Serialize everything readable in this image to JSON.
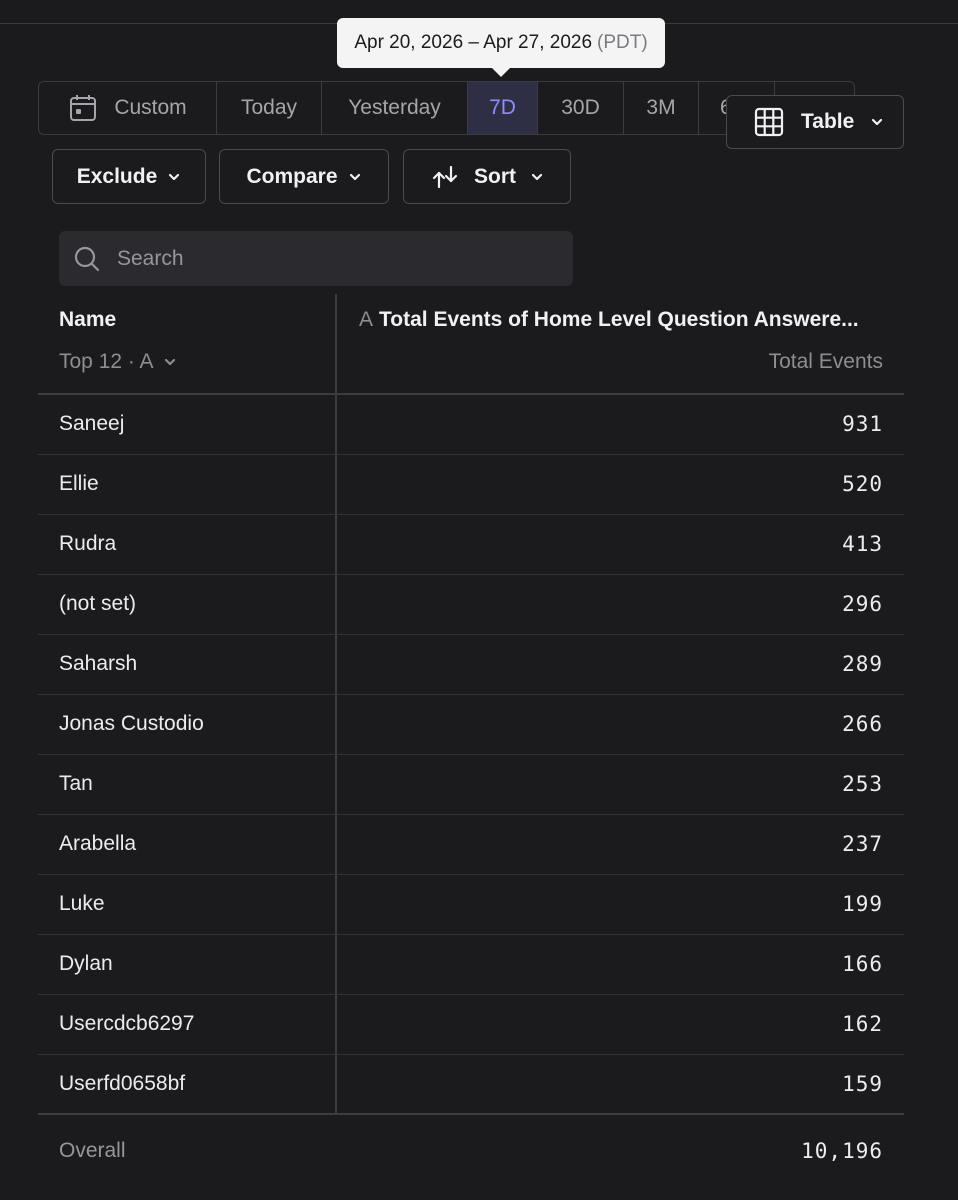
{
  "tooltip": {
    "range": "Apr 20, 2026 – Apr 27, 2026",
    "tz": "(PDT)"
  },
  "date_range": {
    "custom": "Custom",
    "today": "Today",
    "yesterday": "Yesterday",
    "d7": "7D",
    "d30": "30D",
    "m3": "3M",
    "m6": "6",
    "selected": "7D"
  },
  "view": {
    "label": "Table"
  },
  "filters": {
    "exclude": "Exclude",
    "compare": "Compare",
    "sort": "Sort"
  },
  "search": {
    "placeholder": "Search"
  },
  "table": {
    "name_header": "Name",
    "top_label": "Top 12 · A",
    "metric_letter": "A",
    "metric_header": "Total Events of Home Level Question Answere...",
    "metric_sub": "Total Events",
    "rows": [
      {
        "name": "Saneej",
        "value": "931"
      },
      {
        "name": "Ellie",
        "value": "520"
      },
      {
        "name": "Rudra",
        "value": "413"
      },
      {
        "name": "(not set)",
        "value": "296"
      },
      {
        "name": "Saharsh",
        "value": "289"
      },
      {
        "name": "Jonas Custodio",
        "value": "266"
      },
      {
        "name": "Tan",
        "value": "253"
      },
      {
        "name": "Arabella",
        "value": "237"
      },
      {
        "name": "Luke",
        "value": "199"
      },
      {
        "name": "Dylan",
        "value": "166"
      },
      {
        "name": "Usercdcb6297",
        "value": "162"
      },
      {
        "name": "Userfd0658bf",
        "value": "159"
      }
    ],
    "overall_label": "Overall",
    "overall_value": "10,196"
  },
  "colors": {
    "background": "#1b1b1d",
    "accent": "#8d8dff",
    "selected_bg": "#2e2e44"
  }
}
